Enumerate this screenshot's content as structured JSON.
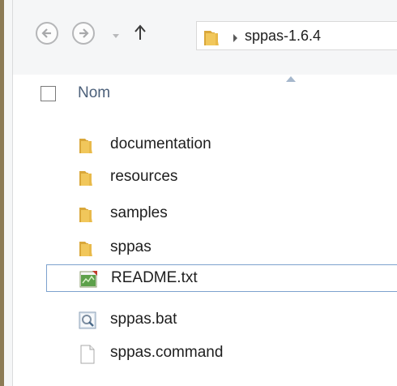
{
  "navigation": {
    "back_icon": "back-arrow-icon",
    "forward_icon": "forward-arrow-icon",
    "recent_icon": "chevron-down-icon",
    "up_icon": "up-arrow-icon"
  },
  "address": {
    "folder_icon": "folder-icon",
    "separator_icon": "chevron-right-icon",
    "path": "sppas-1.6.4"
  },
  "list_header": {
    "name_column": "Nom",
    "sort_indicator": "sort-ascending-icon"
  },
  "files": [
    {
      "name": "documentation",
      "icon": "folder-icon",
      "selected": false
    },
    {
      "name": "resources",
      "icon": "folder-icon",
      "selected": false
    },
    {
      "name": "samples",
      "icon": "folder-icon",
      "selected": false
    },
    {
      "name": "sppas",
      "icon": "folder-icon",
      "selected": false
    },
    {
      "name": "README.txt",
      "icon": "text-file-icon",
      "selected": true
    },
    {
      "name": "sppas.bat",
      "icon": "batch-file-icon",
      "selected": false
    },
    {
      "name": "sppas.command",
      "icon": "blank-file-icon",
      "selected": false
    }
  ],
  "colors": {
    "folder": "#e8b94a",
    "selection_border": "#7da2ce",
    "header_text": "#4c607a",
    "toolbar_bg": "#f5f6f7"
  }
}
